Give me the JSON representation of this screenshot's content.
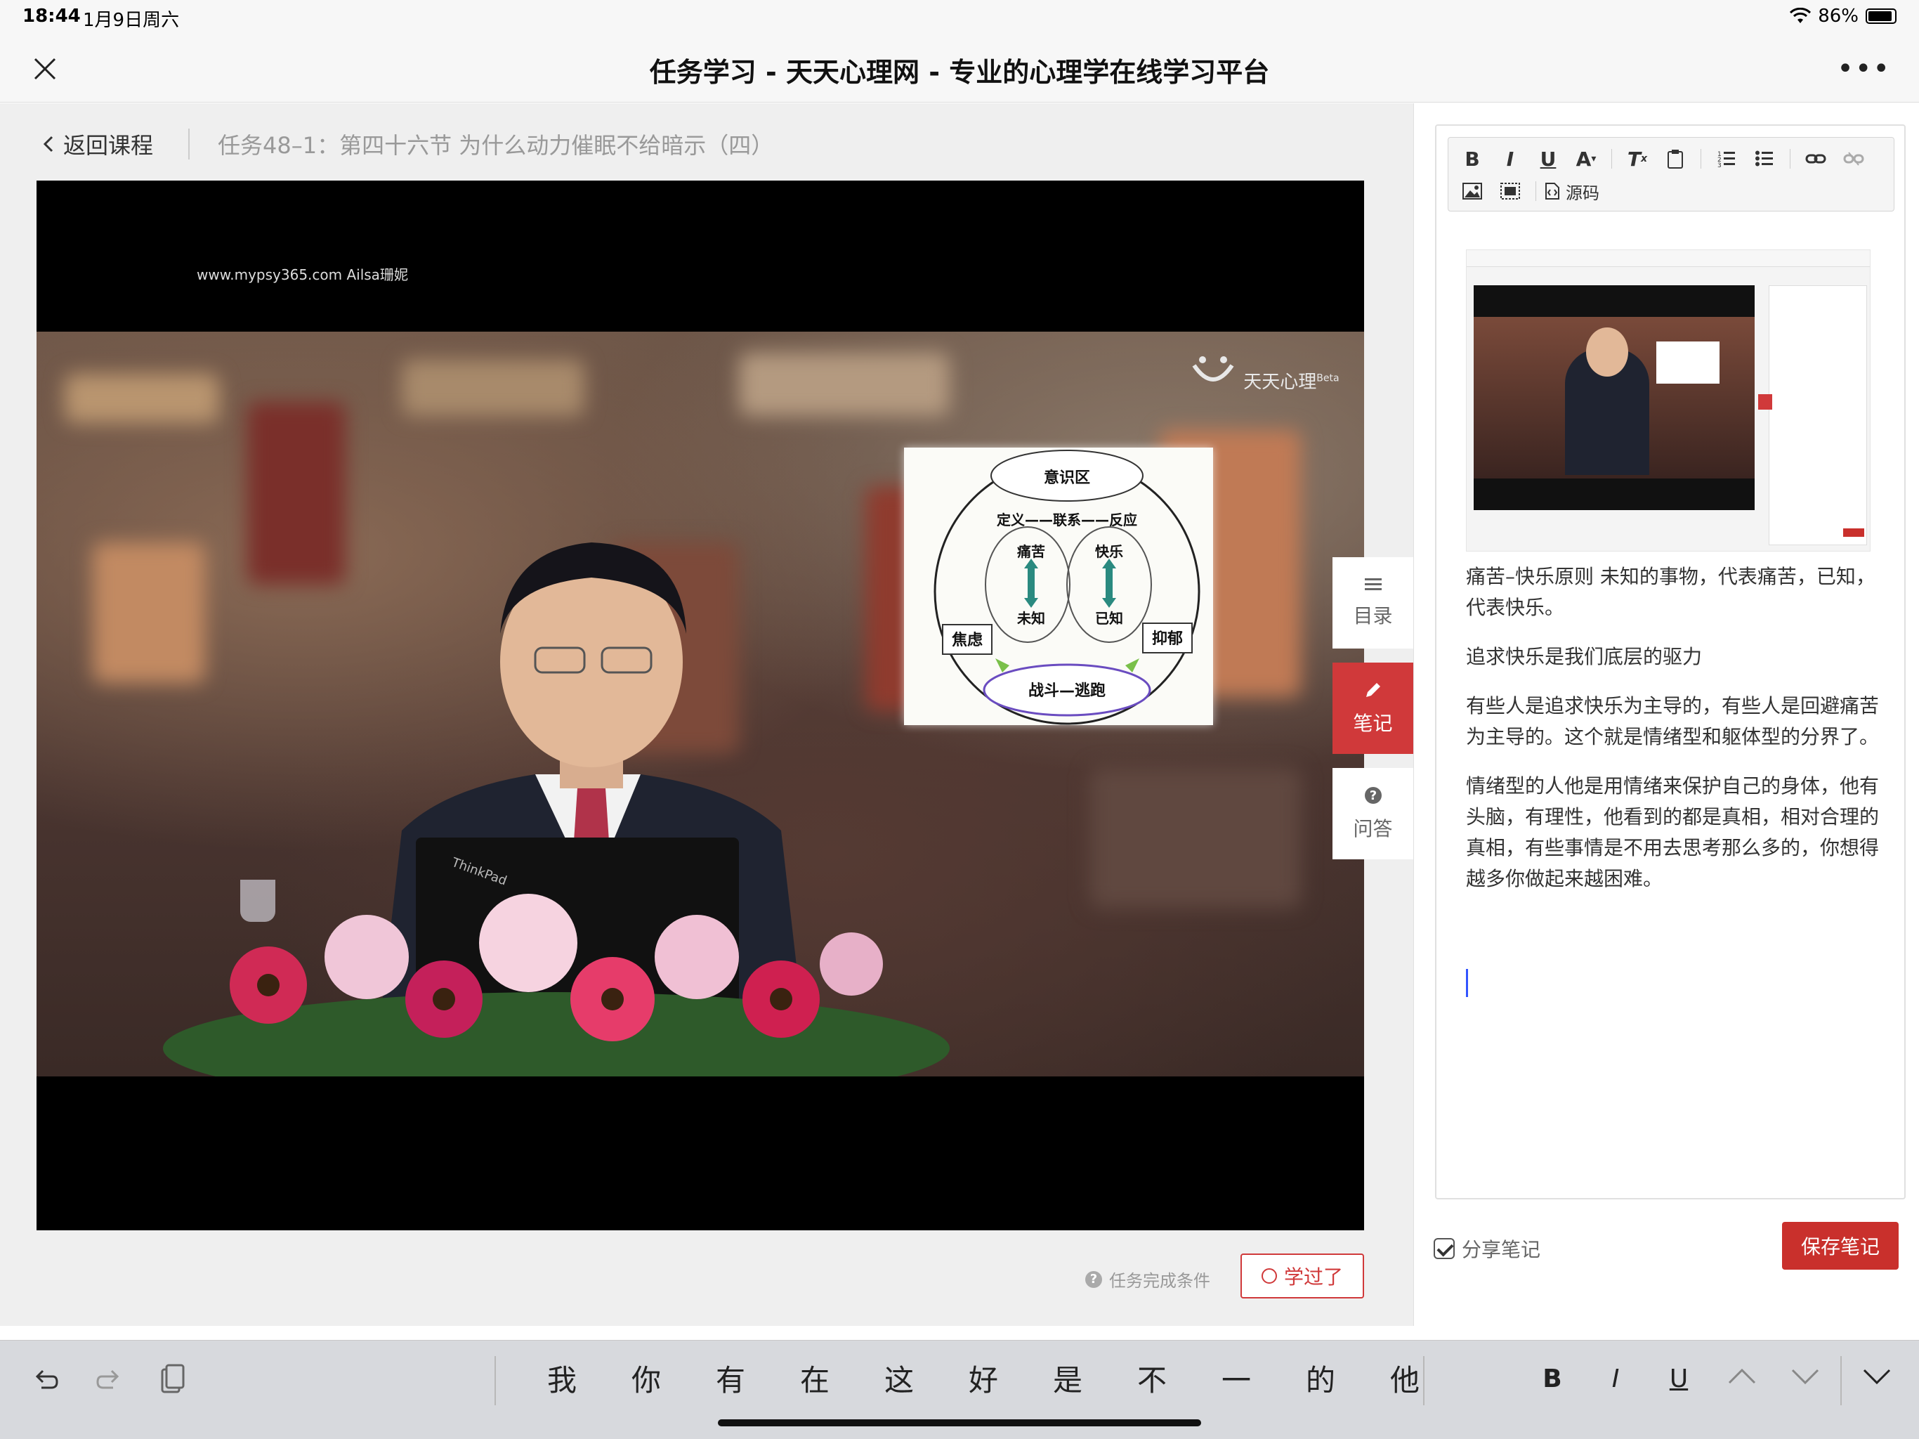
{
  "status": {
    "time": "18:44",
    "date": "1月9日周六",
    "battery": "86%"
  },
  "nav": {
    "title": "任务学习 - 天天心理网 - 专业的心理学在线学习平台"
  },
  "breadcrumb": {
    "back_label": "返回课程",
    "task_title": "任务48–1：第四十六节 为什么动力催眠不给暗示（四）"
  },
  "video": {
    "watermark": "www.mypsy365.com Ailsa珊妮",
    "brand_name": "天天心理",
    "brand_sup": "Beta",
    "diagram": {
      "top": "意识区",
      "middle": "定义——联系——反应",
      "left_top": "痛苦",
      "left_bottom": "未知",
      "right_top": "快乐",
      "right_bottom": "已知",
      "left_box": "焦虑",
      "right_box": "抑郁",
      "bottom": "战斗—逃跑"
    }
  },
  "task": {
    "condition_label": "任务完成条件",
    "learned_label": "学过了"
  },
  "side_tabs": [
    {
      "label": "目录",
      "icon": "list-icon"
    },
    {
      "label": "笔记",
      "icon": "pencil-icon"
    },
    {
      "label": "问答",
      "icon": "question-icon"
    }
  ],
  "editor": {
    "source_label": "源码",
    "paragraphs": [
      "痛苦–快乐原则  未知的事物，代表痛苦，已知，代表快乐。",
      "追求快乐是我们底层的驱力",
      "有些人是追求快乐为主导的，有些人是回避痛苦为主导的。这个就是情绪型和躯体型的分界了。",
      "情绪型的人他是用情绪来保护自己的身体，他有头脑，有理性，他看到的都是真相，相对合理的真相，有些事情是不用去思考那么多的，你想得越多你做起来越困难。"
    ]
  },
  "footer": {
    "share_label": "分享笔记",
    "save_label": "保存笔记"
  },
  "keyboard": {
    "candidates": [
      "我",
      "你",
      "有",
      "在",
      "这",
      "好",
      "是",
      "不",
      "一",
      "的",
      "他"
    ],
    "format_buttons": [
      "B",
      "I",
      "U"
    ]
  },
  "colors": {
    "accent": "#d0393a",
    "save": "#c9302c"
  }
}
